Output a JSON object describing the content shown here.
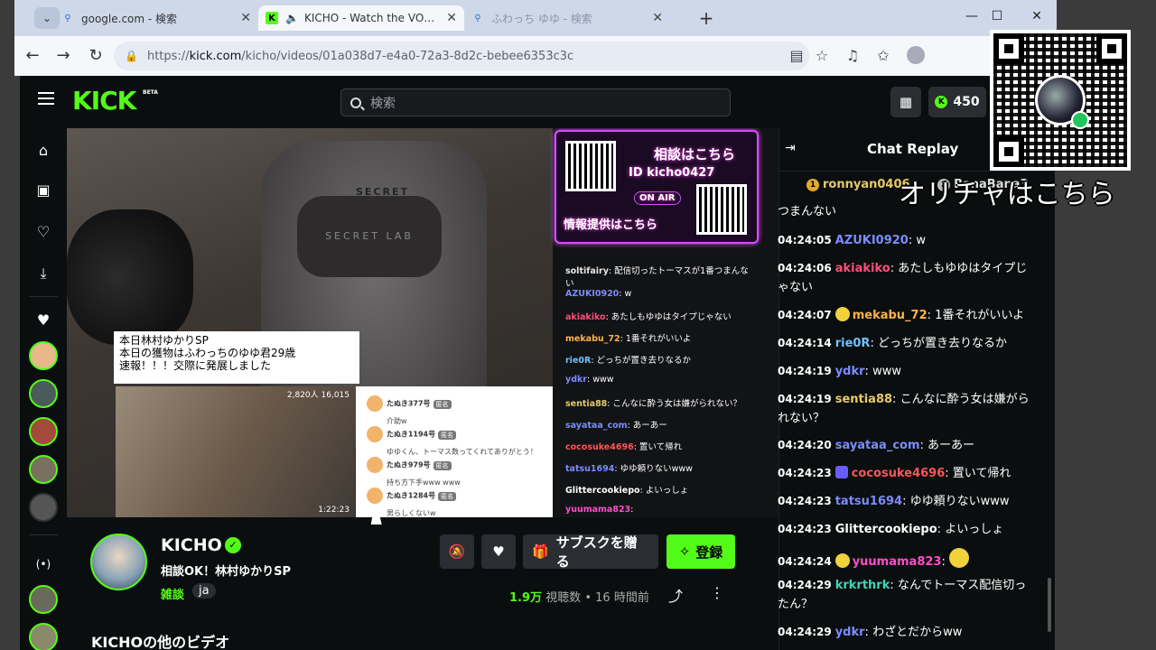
{
  "browser": {
    "tabs": [
      {
        "title": "google.com - 検索",
        "active": false
      },
      {
        "title": "KICHO - Watch the VOD on Kick",
        "active": true
      },
      {
        "title": "ふわっち ゆゆ - 検索",
        "active": false
      }
    ],
    "url_scheme": "https://",
    "url_host": "kick.com",
    "url_path": "/kicho/videos/01a038d7-e4a0-72a3-8d2c-bebee6353c3c"
  },
  "kick": {
    "logo": "KICK",
    "logo_badge": "BETA",
    "search_placeholder": "検索",
    "points": "450"
  },
  "video": {
    "caption_lines": [
      "本日林村ゆかりSP",
      "本日の獲物はふわっちのゆゆ君29歳",
      "速報！！！交際に発展しました"
    ],
    "clip_stats": "2,820人 16,015",
    "clip_duration": "1:22:23",
    "pillow_text": "SECRET LAB",
    "chair_brand": "SECRET",
    "clip_chat": [
      {
        "name": "たぬき377号",
        "tag": "匿名",
        "msg": "介助w"
      },
      {
        "name": "たぬき1194号",
        "tag": "匿名",
        "msg": "ゆゆくん、トーマス数ってくれてありがとう！"
      },
      {
        "name": "たぬき979号",
        "tag": "匿名",
        "msg": "持ち方下手www www"
      },
      {
        "name": "たぬき1284号",
        "tag": "匿名",
        "msg": "男らしくないw"
      }
    ],
    "banner": {
      "line1": "相談はこちら",
      "line2": "ID kicho0427",
      "onair": "ON AIR",
      "line3": "情報提供はこちら"
    },
    "overlay_chat": [
      {
        "user": "soltifairy",
        "color": "#e6e6e6",
        "text": "配信切ったトーマスが1番つまんない"
      },
      {
        "user": "AZUKI0920",
        "color": "#7b8cff",
        "text": "w"
      },
      {
        "user": "akiakiko",
        "color": "#ff4d7a",
        "text": "あたしもゆゆはタイプじゃない"
      },
      {
        "user": "mekabu_72",
        "color": "#ffb347",
        "text": "1番それがいいよ"
      },
      {
        "user": "rie0R",
        "color": "#6ec1ff",
        "text": "どっちが置き去りなるか"
      },
      {
        "user": "ydkr",
        "color": "#7b8cff",
        "text": "www"
      },
      {
        "user": "sentia88",
        "color": "#e6c96b",
        "text": "こんなに酔う女は嫌がられない？"
      },
      {
        "user": "sayataa_com",
        "color": "#7b8cff",
        "text": "あーあー"
      },
      {
        "user": "cocosuke4696",
        "color": "#ff5555",
        "text": "置いて帰れ"
      },
      {
        "user": "tatsu1694",
        "color": "#7b8cff",
        "text": "ゆゆ頼りないwww"
      },
      {
        "user": "Glittercookiepo",
        "color": "#ffffff",
        "text": "よいっしょ"
      },
      {
        "user": "yuumama823",
        "color": "#ff4dcb",
        "text": ""
      }
    ]
  },
  "channel": {
    "name": "KICHO",
    "stream_title": "相談OK！林村ゆかりSP",
    "category": "雑談",
    "language": "ja",
    "views_count": "1.9万",
    "views_label": "視聴数",
    "time_ago": "16 時間前",
    "subscribe_gift": "サブスクを贈る",
    "follow": "登録",
    "other_videos": "KICHOの他のビデオ"
  },
  "chat": {
    "title": "Chat Replay",
    "pinned": [
      {
        "rank": "1",
        "user": "ronnyan0406"
      },
      {
        "rank": "2",
        "user": "BanaBana3"
      }
    ],
    "cut_message": "つまんない",
    "messages": [
      {
        "ts": "04:24:05",
        "user": "AZUKI0920",
        "color": "#7b8cff",
        "text": "w"
      },
      {
        "ts": "04:24:06",
        "user": "akiakiko",
        "color": "#ff4d7a",
        "text": "あたしもゆゆはタイプじゃない"
      },
      {
        "ts": "04:24:07",
        "user": "mekabu_72",
        "color": "#ffb347",
        "text": "1番それがいいよ"
      },
      {
        "ts": "04:24:14",
        "user": "rie0R",
        "color": "#6ec1ff",
        "text": "どっちが置き去りなるか"
      },
      {
        "ts": "04:24:19",
        "user": "ydkr",
        "color": "#7b8cff",
        "text": "www"
      },
      {
        "ts": "04:24:19",
        "user": "sentia88",
        "color": "#e6c96b",
        "text": "こんなに酔う女は嫌がられない？"
      },
      {
        "ts": "04:24:20",
        "user": "sayataa_com",
        "color": "#7b8cff",
        "text": "あーあー"
      },
      {
        "ts": "04:24:23",
        "user": "cocosuke4696",
        "color": "#ff5555",
        "text": "置いて帰れ"
      },
      {
        "ts": "04:24:23",
        "user": "tatsu1694",
        "color": "#7b8cff",
        "text": "ゆゆ頼りないwww"
      },
      {
        "ts": "04:24:23",
        "user": "Glittercookiepo",
        "color": "#ffffff",
        "text": "よいっしょ"
      },
      {
        "ts": "04:24:24",
        "user": "yuumama823",
        "color": "#ff4dcb",
        "text": ""
      },
      {
        "ts": "04:24:29",
        "user": "krkrthrk",
        "color": "#3dd6b8",
        "text": "なんでトーマス配信切ったん？"
      },
      {
        "ts": "04:24:29",
        "user": "ydkr",
        "color": "#7b8cff",
        "text": "わざとだからww"
      }
    ]
  },
  "overlay": {
    "text": "オリチャはこちら"
  },
  "colors": {
    "kick_green": "#53fc18",
    "page_bg": "#0b0e0f"
  }
}
